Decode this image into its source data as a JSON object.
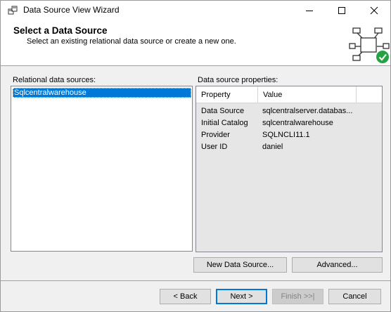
{
  "window": {
    "title": "Data Source View Wizard"
  },
  "header": {
    "title": "Select a Data Source",
    "subtitle": "Select an existing relational data source or create a new one."
  },
  "left_panel": {
    "label": "Relational data sources:",
    "items": [
      {
        "label": "Sqlcentralwarehouse",
        "selected": true
      }
    ]
  },
  "right_panel": {
    "label": "Data source properties:",
    "columns": [
      "Property",
      "Value"
    ],
    "rows": [
      {
        "name": "Data Source",
        "value": "sqlcentralserver.databas..."
      },
      {
        "name": "Initial Catalog",
        "value": "sqlcentralwarehouse"
      },
      {
        "name": "Provider",
        "value": "SQLNCLI11.1"
      },
      {
        "name": "User ID",
        "value": "daniel"
      }
    ]
  },
  "actions": {
    "new_data_source": "New Data Source...",
    "advanced": "Advanced..."
  },
  "footer": {
    "back": "< Back",
    "next": "Next >",
    "finish": "Finish >>|",
    "cancel": "Cancel"
  },
  "colors": {
    "selection": "#0078d7",
    "check_green": "#27a243"
  }
}
